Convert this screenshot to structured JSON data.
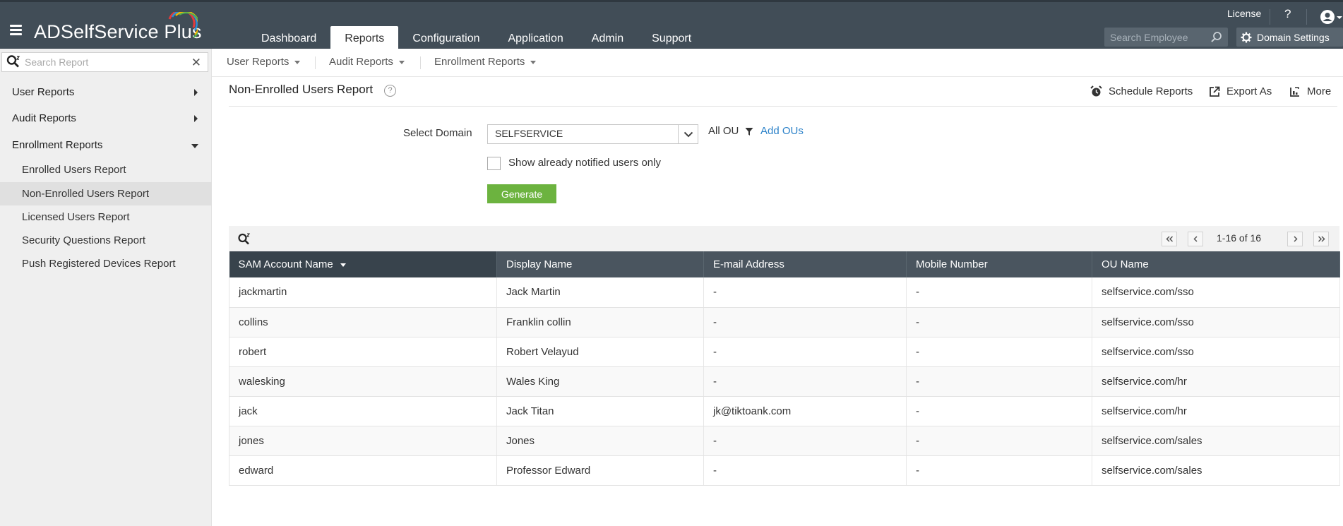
{
  "header": {
    "brand": "ADSelfService Plus",
    "nav_tabs": [
      {
        "label": "Dashboard"
      },
      {
        "label": "Reports"
      },
      {
        "label": "Configuration"
      },
      {
        "label": "Application"
      },
      {
        "label": "Admin"
      },
      {
        "label": "Support"
      }
    ],
    "active_tab": "Reports",
    "license_label": "License",
    "help_label": "?",
    "search_employee_placeholder": "Search Employee",
    "domain_settings_label": "Domain Settings"
  },
  "sidebar": {
    "search_placeholder": "Search Report",
    "categories": [
      {
        "label": "User Reports",
        "expanded": false
      },
      {
        "label": "Audit Reports",
        "expanded": false
      },
      {
        "label": "Enrollment Reports",
        "expanded": true
      }
    ],
    "enrollment_items": [
      {
        "label": "Enrolled Users Report"
      },
      {
        "label": "Non-Enrolled Users Report"
      },
      {
        "label": "Licensed Users Report"
      },
      {
        "label": "Security Questions Report"
      },
      {
        "label": "Push Registered Devices Report"
      }
    ],
    "active_item": "Non-Enrolled Users Report"
  },
  "subnav": {
    "items": [
      {
        "label": "User Reports"
      },
      {
        "label": "Audit Reports"
      },
      {
        "label": "Enrollment Reports"
      }
    ]
  },
  "report": {
    "title": "Non-Enrolled Users Report",
    "help": "?",
    "actions": {
      "schedule": "Schedule Reports",
      "export": "Export As",
      "more": "More"
    }
  },
  "form": {
    "select_domain_label": "Select Domain",
    "domain_value": "SELFSERVICE",
    "ou_label": "All OU",
    "add_ous_label": "Add OUs",
    "checkbox_label": "Show already notified users only",
    "checkbox_checked": false,
    "generate_label": "Generate"
  },
  "table": {
    "pagination": "1-16 of 16",
    "sort_column": "SAM Account Name",
    "columns": [
      "SAM Account Name",
      "Display Name",
      "E-mail Address",
      "Mobile Number",
      "OU Name"
    ],
    "rows": [
      [
        "jackmartin",
        "Jack Martin",
        "-",
        "-",
        "selfservice.com/sso"
      ],
      [
        "collins",
        "Franklin collin",
        "-",
        "-",
        "selfservice.com/sso"
      ],
      [
        "robert",
        "Robert Velayud",
        "-",
        "-",
        "selfservice.com/sso"
      ],
      [
        "walesking",
        "Wales King",
        "-",
        "-",
        "selfservice.com/hr"
      ],
      [
        "jack",
        "Jack Titan",
        "jk@tiktoank.com",
        "-",
        "selfservice.com/hr"
      ],
      [
        "jones",
        "Jones",
        "-",
        "-",
        "selfservice.com/sales"
      ],
      [
        "edward",
        "Professor Edward",
        "-",
        "-",
        "selfservice.com/sales"
      ]
    ]
  },
  "colors": {
    "header_bg": "#414d57",
    "sidebar_bg": "#efefef",
    "table_header_bg": "#4a555f",
    "generate_green": "#6cb33f",
    "link_blue": "#2c82c9"
  },
  "icons": {
    "menu": "hamburger-icon",
    "help": "question-icon",
    "user": "user-circle-icon",
    "search": "search-icon",
    "settings": "gear-icon",
    "schedule": "alarm-clock-icon",
    "export": "export-icon",
    "more": "more-icon",
    "filter": "filter-icon"
  }
}
